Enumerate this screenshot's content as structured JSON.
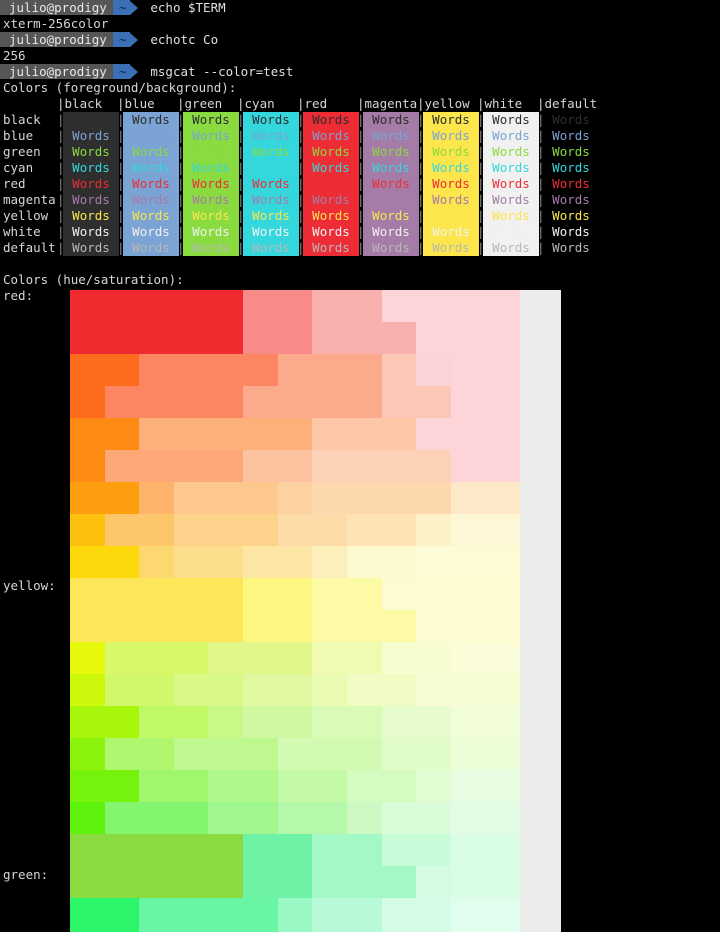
{
  "terminal": {
    "lines": [
      {
        "type": "prompt",
        "user": "julio@prodigy",
        "dir": "~",
        "cmd": "echo $TERM"
      },
      {
        "type": "output",
        "text": "xterm-256color"
      },
      {
        "type": "prompt",
        "user": "julio@prodigy",
        "dir": "~",
        "cmd": "echotc Co"
      },
      {
        "type": "output",
        "text": "256"
      },
      {
        "type": "prompt",
        "user": "julio@prodigy",
        "dir": "~",
        "cmd": "msgcat --color=test"
      }
    ]
  },
  "fgbg": {
    "title": "Colors (foreground/background):",
    "word": "Words",
    "columns": [
      "black",
      "blue",
      "green",
      "cyan",
      "red",
      "magenta",
      "yellow",
      "white",
      "default"
    ],
    "rows": [
      "black",
      "blue",
      "green",
      "cyan",
      "red",
      "magenta",
      "yellow",
      "white",
      "default"
    ],
    "bg_colors": {
      "black": "#2e2e2e",
      "blue": "#7ba3d3",
      "green": "#8adb3f",
      "cyan": "#34d8dc",
      "red": "#ee2c36",
      "magenta": "#a57ca8",
      "yellow": "#fce64c",
      "white": "#f1f1f1",
      "default": "#000000"
    },
    "fg_colors": {
      "black": "#2e2e2e",
      "blue": "#7ba3d3",
      "green": "#8adb3f",
      "cyan": "#34d8dc",
      "red": "#ee2c36",
      "magenta": "#a57ca8",
      "yellow": "#fce64c",
      "white": "#f1f1f1",
      "default": "#b8b8b8"
    }
  },
  "hue": {
    "title": "Colors (hue/saturation):",
    "labels": [
      "red:",
      "yellow:",
      "green:"
    ],
    "bands": [
      [
        "#ef2b2f",
        "#ef2b2f",
        "#ef2b2f",
        "#ef2b2f",
        "#ef2b2f",
        "#f98a8a",
        "#f98a8a",
        "#fbb0b0",
        "#fbb0b0",
        "#fdd4d8",
        "#fdd4d8",
        "#fdd4d8",
        "#fdd4d8",
        "#ececea"
      ],
      [
        "#ef2b2f",
        "#ef2b2f",
        "#ef2b2f",
        "#ef2b2f",
        "#ef2b2f",
        "#f98a8a",
        "#f98a8a",
        "#fbb0b0",
        "#fbb0b0",
        "#fbb0b0",
        "#fdd4d8",
        "#fdd4d8",
        "#fdd4d8",
        "#ececea"
      ],
      [
        "#fd6b1d",
        "#fd6b1d",
        "#fb8661",
        "#fb8661",
        "#fb8661",
        "#fb8661",
        "#fbaa8c",
        "#fbaa8c",
        "#fbaa8c",
        "#fbc8b8",
        "#fbd3d7",
        "#fdd4d8",
        "#fdd4d8",
        "#ececea"
      ],
      [
        "#fd6b1d",
        "#fb8661",
        "#fb8661",
        "#fb8661",
        "#fb8661",
        "#fbaa8c",
        "#fbaa8c",
        "#fbaa8c",
        "#fbaa8c",
        "#fbc8b8",
        "#fbc8b8",
        "#fdd4d8",
        "#fdd4d8",
        "#ececea"
      ],
      [
        "#fd8a12",
        "#fd8a12",
        "#fdb07a",
        "#fdb07a",
        "#fdb07a",
        "#fdb07a",
        "#fdb07a",
        "#fdc7a8",
        "#fdc7a8",
        "#fdc7a8",
        "#fdd4d8",
        "#fdd4d8",
        "#fdd4d8",
        "#ececea"
      ],
      [
        "#fd8a12",
        "#fda876",
        "#fda876",
        "#fda876",
        "#fda876",
        "#fdc3a0",
        "#fdc3a0",
        "#fdd1b6",
        "#fdd1b6",
        "#fdd1b6",
        "#fdd1b6",
        "#fdd4d8",
        "#fdd4d8",
        "#ececea"
      ],
      [
        "#fd9e0e",
        "#fd9e0e",
        "#fdb46a",
        "#fdc88c",
        "#fdc88c",
        "#fdc88c",
        "#fdd2a2",
        "#fdd8ae",
        "#fdd8ae",
        "#fdd8ae",
        "#fdd8ae",
        "#fde9c8",
        "#fde9c8",
        "#ececea"
      ],
      [
        "#fdc00e",
        "#fdc66a",
        "#fdc66a",
        "#fdd38c",
        "#fdd38c",
        "#fdd38c",
        "#fddcaa",
        "#fddcaa",
        "#fde3b6",
        "#fde3b6",
        "#fdf1c8",
        "#fdf7d6",
        "#fdf7d6",
        "#ececea"
      ],
      [
        "#fdd90c",
        "#fdd90c",
        "#fdd870",
        "#fdde8c",
        "#fdde8c",
        "#fde6a4",
        "#fde6a4",
        "#fdefbc",
        "#fdfad0",
        "#fdfad0",
        "#fdfbd6",
        "#fdfbd6",
        "#fdfbd6",
        "#ececea"
      ],
      [
        "#fee659",
        "#fee659",
        "#fee659",
        "#fee659",
        "#fee659",
        "#fdf781",
        "#fdf781",
        "#fdfaa6",
        "#fdfaa6",
        "#fdfcd0",
        "#fdfcd0",
        "#fdfcd0",
        "#fdfcd0",
        "#ececea"
      ],
      [
        "#fee659",
        "#fee659",
        "#fee659",
        "#fee659",
        "#fee659",
        "#fdf781",
        "#fdf781",
        "#fdfaa6",
        "#fdfaa6",
        "#fdfaa6",
        "#fdfcd0",
        "#fdfcd0",
        "#fdfcd0",
        "#ececea"
      ],
      [
        "#e6f80c",
        "#d8f86a",
        "#d8f86a",
        "#d8f86a",
        "#e2f78a",
        "#e2f78a",
        "#e2f78a",
        "#f0fab0",
        "#f0fab0",
        "#f8fdd0",
        "#f8fdd0",
        "#fbfdd8",
        "#fbfdd8",
        "#ececea"
      ],
      [
        "#cdf80c",
        "#d0f86a",
        "#d0f86a",
        "#d8f888",
        "#d8f888",
        "#e0f9a0",
        "#e0f9a0",
        "#e8fbb0",
        "#f0fcc4",
        "#f0fcc4",
        "#f6fdd4",
        "#f6fdd4",
        "#f6fdd4",
        "#ececea"
      ],
      [
        "#a8f60c",
        "#a8f60c",
        "#c0f866",
        "#c0f866",
        "#c8f886",
        "#d0f8a0",
        "#d0f8a0",
        "#dafab8",
        "#dafab8",
        "#e6fccc",
        "#e6fccc",
        "#f0fdd8",
        "#f0fdd8",
        "#ececea"
      ],
      [
        "#8cf40c",
        "#b0f770",
        "#b0f770",
        "#c0f890",
        "#c0f890",
        "#c0f890",
        "#d2fab2",
        "#d2fab2",
        "#d2fab2",
        "#e0fcc8",
        "#e0fcc8",
        "#eafdd6",
        "#eafdd6",
        "#ececea"
      ],
      [
        "#75f30c",
        "#75f30c",
        "#a0f76c",
        "#a0f76c",
        "#b0f88c",
        "#b0f88c",
        "#c4f9a8",
        "#c4f9a8",
        "#d4fbc0",
        "#d4fbc0",
        "#e2fcd4",
        "#e6fde2",
        "#e6fde2",
        "#ececea"
      ],
      [
        "#5cf20c",
        "#84f56e",
        "#84f56e",
        "#84f56e",
        "#a0f78e",
        "#a0f78e",
        "#b6f8aa",
        "#b6f8aa",
        "#ccfac2",
        "#dafcd8",
        "#dafcd8",
        "#e2fde4",
        "#e2fde4",
        "#ececea"
      ],
      [
        "#8adb3f",
        "#8adb3f",
        "#8adb3f",
        "#8adb3f",
        "#8adb3f",
        "#6ef3a6",
        "#6ef3a6",
        "#a4f8c8",
        "#a4f8c8",
        "#c8fbd8",
        "#c8fbd8",
        "#dafde6",
        "#dafde6",
        "#ececea"
      ],
      [
        "#8adb3f",
        "#8adb3f",
        "#8adb3f",
        "#8adb3f",
        "#8adb3f",
        "#6ef3a6",
        "#6ef3a6",
        "#a4f8c8",
        "#a4f8c8",
        "#a4f8c8",
        "#d4fce2",
        "#dafde6",
        "#dafde6",
        "#ececea"
      ],
      [
        "#2cf56a",
        "#2cf56a",
        "#6af5a4",
        "#6af5a4",
        "#6af5a4",
        "#6af5a4",
        "#9af8c4",
        "#b8fad8",
        "#b8fad8",
        "#d4fce6",
        "#d4fce6",
        "#e0fdee",
        "#e0fdee",
        "#ececea"
      ]
    ]
  }
}
